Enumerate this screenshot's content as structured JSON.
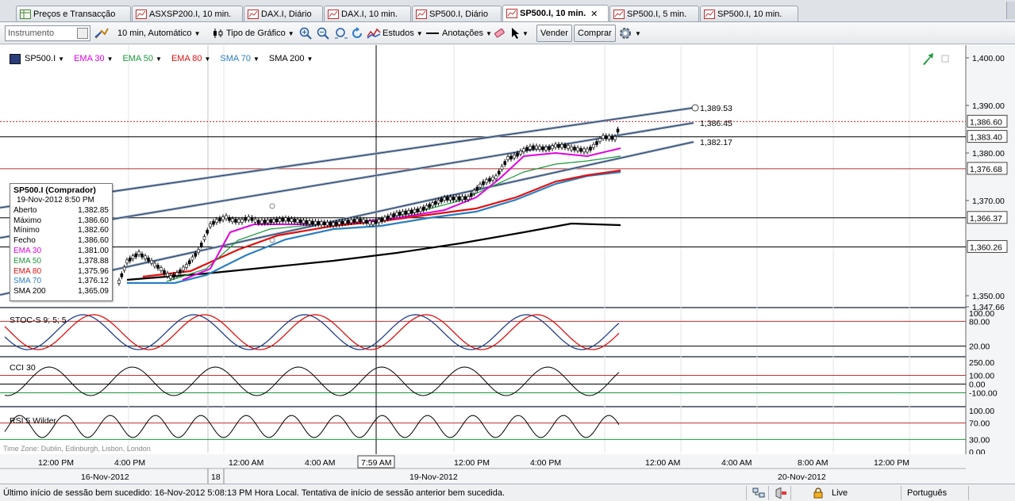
{
  "tabs": [
    {
      "label": "Preços e Transacção",
      "icon": "price-grid-icon",
      "active": false
    },
    {
      "label": "ASXSP200.I, 10 min.",
      "icon": "chart-icon",
      "active": false
    },
    {
      "label": "DAX.I, Diário",
      "icon": "chart-icon",
      "active": false
    },
    {
      "label": "DAX.I, 10 min.",
      "icon": "chart-icon",
      "active": false
    },
    {
      "label": "SP500.I, Diário",
      "icon": "chart-icon",
      "active": false
    },
    {
      "label": "SP500.I, 10 min.",
      "icon": "chart-icon",
      "active": true,
      "close": "✕"
    },
    {
      "label": "SP500.I, 5 min.",
      "icon": "chart-icon",
      "active": false
    },
    {
      "label": "SP500.I, 10 min.",
      "icon": "chart-icon",
      "active": false
    }
  ],
  "toolbar": {
    "instrument_placeholder": "Instrumento",
    "interval": "10 min, Automático",
    "chart_type": "Tipo de Gráfico",
    "studies": "Estudos",
    "annotations": "Anotações",
    "sell": "Vender",
    "buy": "Comprar"
  },
  "legend": [
    {
      "label": "SP500.I",
      "color": "#000000"
    },
    {
      "label": "EMA 30",
      "color": "#e000e0"
    },
    {
      "label": "EMA 50",
      "color": "#1a9a3a"
    },
    {
      "label": "EMA 80",
      "color": "#e01010"
    },
    {
      "label": "SMA 70",
      "color": "#2a7fc0"
    },
    {
      "label": "SMA 200",
      "color": "#000000"
    }
  ],
  "data_window": {
    "title": "SP500.I (Comprador)",
    "date": "19-Nov-2012 8:50 PM",
    "rows": [
      {
        "label": "Aberto",
        "value": "1,382.85",
        "color": "#000000"
      },
      {
        "label": "Máximo",
        "value": "1,386.60",
        "color": "#000000"
      },
      {
        "label": "Mínimo",
        "value": "1,382.60",
        "color": "#000000"
      },
      {
        "label": "Fecho",
        "value": "1,386.60",
        "color": "#000000"
      },
      {
        "label": "EMA 30",
        "value": "1,381.00",
        "color": "#e000e0"
      },
      {
        "label": "EMA 50",
        "value": "1,378.88",
        "color": "#1a9a3a"
      },
      {
        "label": "EMA 80",
        "value": "1,375.96",
        "color": "#e01010"
      },
      {
        "label": "SMA 70",
        "value": "1,376.12",
        "color": "#2a7fc0"
      },
      {
        "label": "SMA 200",
        "value": "1,365.09",
        "color": "#000000"
      }
    ]
  },
  "price_axis": {
    "ticks": [
      "1,400.00",
      "1,390.00",
      "1,380.00",
      "1,370.00",
      "1,350.00",
      "1,347.66"
    ],
    "boxes": [
      "1,386.60",
      "1,383.40",
      "1,376.68",
      "1,366.37",
      "1,360.26"
    ]
  },
  "channel_labels": [
    "1,389.53",
    "1,386.45",
    "1,382.17"
  ],
  "indicators": [
    {
      "label": "STOC-S 9; 5; 5",
      "ticks": [
        "100.00",
        "80.00",
        "20.00"
      ]
    },
    {
      "label": "CCI 30",
      "ticks": [
        "250.00",
        "100.00",
        "0.00",
        "-100.00"
      ]
    },
    {
      "label": "RSI 5 Wilder",
      "ticks": [
        "100.00",
        "70.00",
        "30.00",
        "0.00"
      ]
    }
  ],
  "timezone": "Time Zone: Dublin, Edinburgh, Lisbon, London",
  "time_axis": {
    "times": [
      "12:00 PM",
      "4:00 PM",
      "12:00 AM",
      "4:00 AM",
      "7:59 AM",
      "12:00 PM",
      "4:00 PM",
      "12:00 AM",
      "4:00 AM",
      "8:00 AM",
      "12:00 PM"
    ],
    "dates": [
      "16-Nov-2012",
      "18",
      "19-Nov-2012",
      "20-Nov-2012"
    ]
  },
  "status": {
    "message": "Último início de sessão bem sucedido: 16-Nov-2012 5:08:13 PM Hora Local. Tentativa de início de sessão anterior bem sucedida.",
    "connection": "Live",
    "language": "Português"
  },
  "colors": {
    "up_arrow": "#1a9a3a",
    "ema30": "#e000e0",
    "ema50": "#1a9a3a",
    "ema80": "#e01010",
    "sma70": "#2a7fc0",
    "sma200": "#000000",
    "stoc_k": "#1f3f8a",
    "stoc_d": "#e01010"
  }
}
